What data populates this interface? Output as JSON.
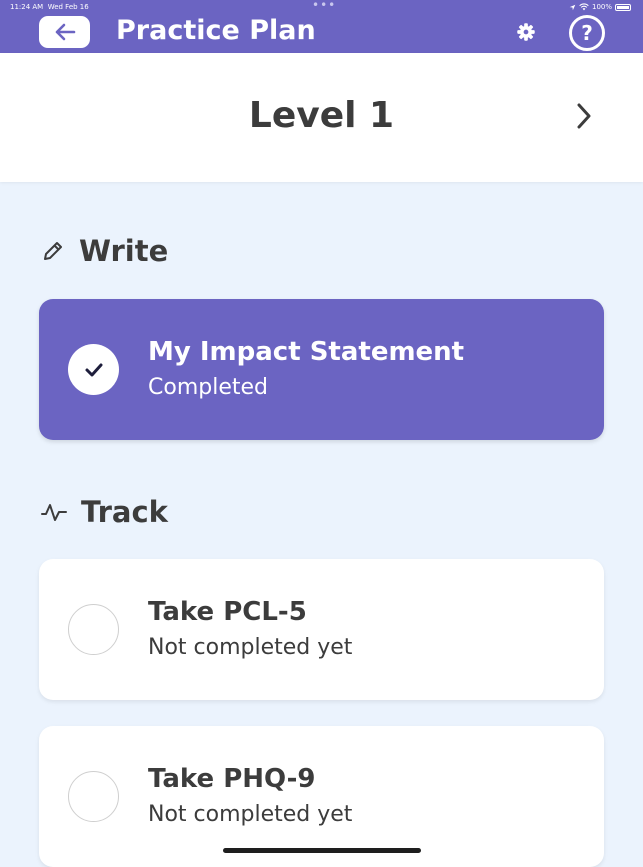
{
  "status_bar": {
    "time": "11:24 AM",
    "date": "Wed Feb 16",
    "battery": "100%"
  },
  "header": {
    "title": "Practice Plan",
    "back_icon": "arrow-left-icon",
    "settings_icon": "gear-icon",
    "help_label": "?"
  },
  "level": {
    "title": "Level 1",
    "next_icon": "chevron-right-icon"
  },
  "sections": {
    "write": {
      "label": "Write",
      "icon": "pencil-icon",
      "items": [
        {
          "title": "My Impact Statement",
          "status": "Completed",
          "completed": true
        }
      ]
    },
    "track": {
      "label": "Track",
      "icon": "activity-icon",
      "items": [
        {
          "title": "Take PCL-5",
          "status": "Not completed yet",
          "completed": false
        },
        {
          "title": "Take PHQ-9",
          "status": "Not completed yet",
          "completed": false
        }
      ]
    }
  },
  "colors": {
    "accent": "#6b64c2",
    "background": "#ebf3fd",
    "card": "#ffffff",
    "text": "#3c3c3c"
  }
}
